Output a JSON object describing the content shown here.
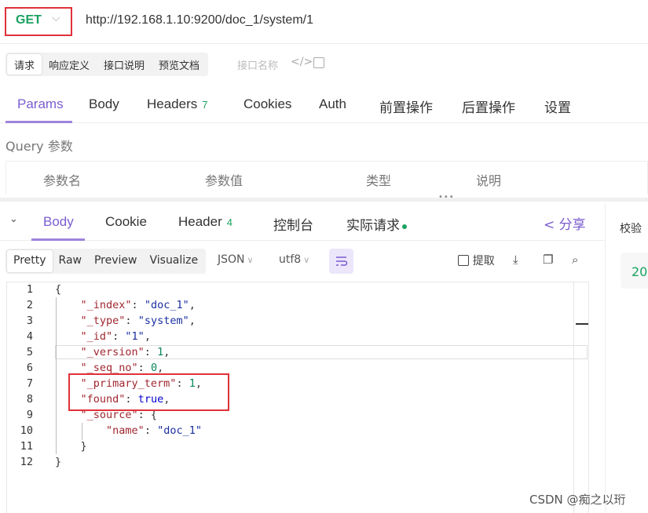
{
  "request": {
    "method": "GET",
    "url": "http://192.168.1.10:9200/doc_1/system/1"
  },
  "segments": {
    "items": [
      "请求",
      "响应定义",
      "接口说明",
      "预览文档"
    ],
    "name_placeholder": "接口名称",
    "code_icon": "</>",
    "panel_icon": "panel-icon"
  },
  "request_tabs": [
    {
      "label": "Params"
    },
    {
      "label": "Body"
    },
    {
      "label": "Headers",
      "count": "7"
    },
    {
      "label": "Cookies"
    },
    {
      "label": "Auth"
    },
    {
      "label": "前置操作"
    },
    {
      "label": "后置操作"
    },
    {
      "label": "设置"
    }
  ],
  "query": {
    "title": "Query 参数",
    "columns": [
      "参数名",
      "参数值",
      "类型",
      "说明"
    ]
  },
  "response_tabs": [
    {
      "label": "Body"
    },
    {
      "label": "Cookie"
    },
    {
      "label": "Header",
      "count": "4"
    },
    {
      "label": "控制台"
    },
    {
      "label": "实际请求"
    }
  ],
  "share_label": "分享",
  "right_panel": {
    "title": "校验",
    "value": "20"
  },
  "format": {
    "modes": [
      "Pretty",
      "Raw",
      "Preview",
      "Visualize"
    ],
    "type": "JSON",
    "encoding": "utf8",
    "extract_label": "提取"
  },
  "code_lines": [
    "{",
    "    \"_index\": \"doc_1\",",
    "    \"_type\": \"system\",",
    "    \"_id\": \"1\",",
    "    \"_version\": 1,",
    "    \"_seq_no\": 0,",
    "    \"_primary_term\": 1,",
    "    \"found\": true,",
    "    \"_source\": {",
    "        \"name\": \"doc_1\"",
    "    }",
    "}"
  ],
  "line_numbers": [
    "1",
    "2",
    "3",
    "4",
    "5",
    "6",
    "7",
    "8",
    "9",
    "10",
    "11",
    "12"
  ],
  "watermark": "CSDN @痴之以珩",
  "colors": {
    "accent": "#7b5ccf",
    "method_green": "#1aa260",
    "highlight_red": "#e0303a"
  }
}
